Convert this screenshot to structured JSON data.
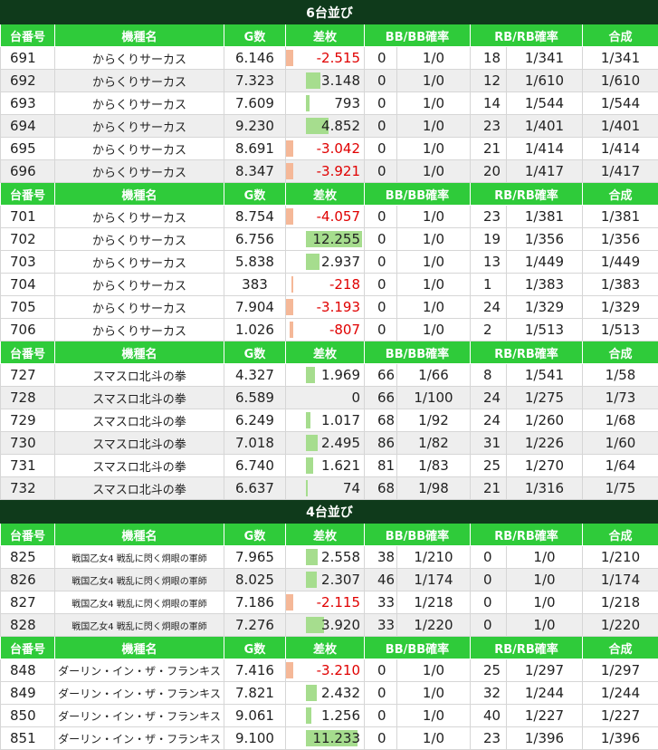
{
  "headers": [
    "台番号",
    "機種名",
    "G数",
    "差枚",
    "BB/BB確率",
    "RB/RB確率",
    "合成"
  ],
  "sections": [
    {
      "title": "6台並び",
      "groups": [
        {
          "rows": [
            {
              "no": "691",
              "name": "からくりサーカス",
              "g": "6.146",
              "diff": "-2.515",
              "diff_value": -2515,
              "bb": "0",
              "bbr": "1/0",
              "rb": "18",
              "rbr": "1/341",
              "total": "1/341"
            },
            {
              "no": "692",
              "name": "からくりサーカス",
              "g": "7.323",
              "diff": "3.148",
              "diff_value": 3148,
              "bb": "0",
              "bbr": "1/0",
              "rb": "12",
              "rbr": "1/610",
              "total": "1/610"
            },
            {
              "no": "693",
              "name": "からくりサーカス",
              "g": "7.609",
              "diff": "793",
              "diff_value": 793,
              "bb": "0",
              "bbr": "1/0",
              "rb": "14",
              "rbr": "1/544",
              "total": "1/544"
            },
            {
              "no": "694",
              "name": "からくりサーカス",
              "g": "9.230",
              "diff": "4.852",
              "diff_value": 4852,
              "bb": "0",
              "bbr": "1/0",
              "rb": "23",
              "rbr": "1/401",
              "total": "1/401"
            },
            {
              "no": "695",
              "name": "からくりサーカス",
              "g": "8.691",
              "diff": "-3.042",
              "diff_value": -3042,
              "bb": "0",
              "bbr": "1/0",
              "rb": "21",
              "rbr": "1/414",
              "total": "1/414"
            },
            {
              "no": "696",
              "name": "からくりサーカス",
              "g": "8.347",
              "diff": "-3.921",
              "diff_value": -3921,
              "bb": "0",
              "bbr": "1/0",
              "rb": "20",
              "rbr": "1/417",
              "total": "1/417"
            }
          ]
        },
        {
          "rows": [
            {
              "no": "701",
              "name": "からくりサーカス",
              "g": "8.754",
              "diff": "-4.057",
              "diff_value": -4057,
              "bb": "0",
              "bbr": "1/0",
              "rb": "23",
              "rbr": "1/381",
              "total": "1/381"
            },
            {
              "no": "702",
              "name": "からくりサーカス",
              "g": "6.756",
              "diff": "12.255",
              "diff_value": 12255,
              "bb": "0",
              "bbr": "1/0",
              "rb": "19",
              "rbr": "1/356",
              "total": "1/356"
            },
            {
              "no": "703",
              "name": "からくりサーカス",
              "g": "5.838",
              "diff": "2.937",
              "diff_value": 2937,
              "bb": "0",
              "bbr": "1/0",
              "rb": "13",
              "rbr": "1/449",
              "total": "1/449"
            },
            {
              "no": "704",
              "name": "からくりサーカス",
              "g": "383",
              "diff": "-218",
              "diff_value": -218,
              "bb": "0",
              "bbr": "1/0",
              "rb": "1",
              "rbr": "1/383",
              "total": "1/383"
            },
            {
              "no": "705",
              "name": "からくりサーカス",
              "g": "7.904",
              "diff": "-3.193",
              "diff_value": -3193,
              "bb": "0",
              "bbr": "1/0",
              "rb": "24",
              "rbr": "1/329",
              "total": "1/329"
            },
            {
              "no": "706",
              "name": "からくりサーカス",
              "g": "1.026",
              "diff": "-807",
              "diff_value": -807,
              "bb": "0",
              "bbr": "1/0",
              "rb": "2",
              "rbr": "1/513",
              "total": "1/513"
            }
          ]
        },
        {
          "rows": [
            {
              "no": "727",
              "name": "スマスロ北斗の拳",
              "g": "4.327",
              "diff": "1.969",
              "diff_value": 1969,
              "bb": "66",
              "bbr": "1/66",
              "rb": "8",
              "rbr": "1/541",
              "total": "1/58"
            },
            {
              "no": "728",
              "name": "スマスロ北斗の拳",
              "g": "6.589",
              "diff": "0",
              "diff_value": 0,
              "bb": "66",
              "bbr": "1/100",
              "rb": "24",
              "rbr": "1/275",
              "total": "1/73"
            },
            {
              "no": "729",
              "name": "スマスロ北斗の拳",
              "g": "6.249",
              "diff": "1.017",
              "diff_value": 1017,
              "bb": "68",
              "bbr": "1/92",
              "rb": "24",
              "rbr": "1/260",
              "total": "1/68"
            },
            {
              "no": "730",
              "name": "スマスロ北斗の拳",
              "g": "7.018",
              "diff": "2.495",
              "diff_value": 2495,
              "bb": "86",
              "bbr": "1/82",
              "rb": "31",
              "rbr": "1/226",
              "total": "1/60"
            },
            {
              "no": "731",
              "name": "スマスロ北斗の拳",
              "g": "6.740",
              "diff": "1.621",
              "diff_value": 1621,
              "bb": "81",
              "bbr": "1/83",
              "rb": "25",
              "rbr": "1/270",
              "total": "1/64"
            },
            {
              "no": "732",
              "name": "スマスロ北斗の拳",
              "g": "6.637",
              "diff": "74",
              "diff_value": 74,
              "bb": "68",
              "bbr": "1/98",
              "rb": "21",
              "rbr": "1/316",
              "total": "1/75"
            }
          ]
        }
      ]
    },
    {
      "title": "4台並び",
      "groups": [
        {
          "rows": [
            {
              "no": "825",
              "name": "戦国乙女4 戦乱に閃く炯眼の軍師",
              "name_size": "small",
              "g": "7.965",
              "diff": "2.558",
              "diff_value": 2558,
              "bb": "38",
              "bbr": "1/210",
              "rb": "0",
              "rbr": "1/0",
              "total": "1/210"
            },
            {
              "no": "826",
              "name": "戦国乙女4 戦乱に閃く炯眼の軍師",
              "name_size": "small",
              "g": "8.025",
              "diff": "2.307",
              "diff_value": 2307,
              "bb": "46",
              "bbr": "1/174",
              "rb": "0",
              "rbr": "1/0",
              "total": "1/174"
            },
            {
              "no": "827",
              "name": "戦国乙女4 戦乱に閃く炯眼の軍師",
              "name_size": "small",
              "g": "7.186",
              "diff": "-2.115",
              "diff_value": -2115,
              "bb": "33",
              "bbr": "1/218",
              "rb": "0",
              "rbr": "1/0",
              "total": "1/218"
            },
            {
              "no": "828",
              "name": "戦国乙女4 戦乱に閃く炯眼の軍師",
              "name_size": "small",
              "g": "7.276",
              "diff": "3.920",
              "diff_value": 3920,
              "bb": "33",
              "bbr": "1/220",
              "rb": "0",
              "rbr": "1/0",
              "total": "1/220"
            }
          ]
        },
        {
          "rows": [
            {
              "no": "848",
              "name": "ダーリン・イン・ザ・フランキス",
              "name_size": "mid",
              "g": "7.416",
              "diff": "-3.210",
              "diff_value": -3210,
              "bb": "0",
              "bbr": "1/0",
              "rb": "25",
              "rbr": "1/297",
              "total": "1/297"
            },
            {
              "no": "849",
              "name": "ダーリン・イン・ザ・フランキス",
              "name_size": "mid",
              "g": "7.821",
              "diff": "2.432",
              "diff_value": 2432,
              "bb": "0",
              "bbr": "1/0",
              "rb": "32",
              "rbr": "1/244",
              "total": "1/244"
            },
            {
              "no": "850",
              "name": "ダーリン・イン・ザ・フランキス",
              "name_size": "mid",
              "g": "9.061",
              "diff": "1.256",
              "diff_value": 1256,
              "bb": "0",
              "bbr": "1/0",
              "rb": "40",
              "rbr": "1/227",
              "total": "1/227"
            },
            {
              "no": "851",
              "name": "ダーリン・イン・ザ・フランキス",
              "name_size": "mid",
              "g": "9.100",
              "diff": "11.233",
              "diff_value": 11233,
              "bb": "0",
              "bbr": "1/0",
              "rb": "23",
              "rbr": "1/396",
              "total": "1/396"
            }
          ]
        }
      ]
    }
  ]
}
